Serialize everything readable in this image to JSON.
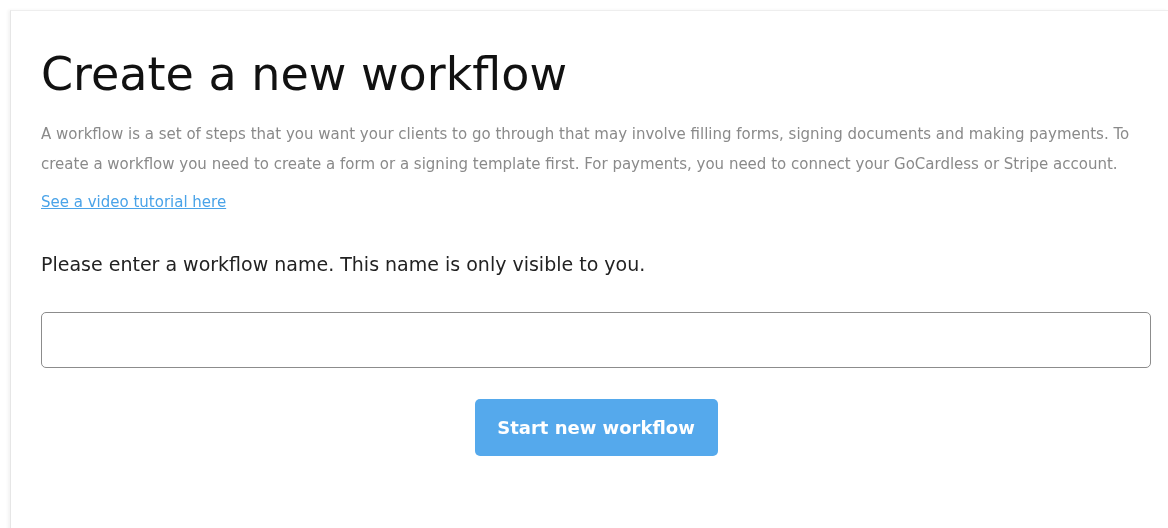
{
  "title": "Create a new workflow",
  "description": "A workflow is a set of steps that you want your clients to go through that may involve filling forms, signing documents and making payments. To create a workflow you need to create a form or a signing template first. For payments, you need to connect your GoCardless or Stripe account.",
  "tutorial_link": "See a video tutorial here",
  "name_prompt": "Please enter a workflow name. This name is only visible to you.",
  "submit_button": "Start new workflow"
}
